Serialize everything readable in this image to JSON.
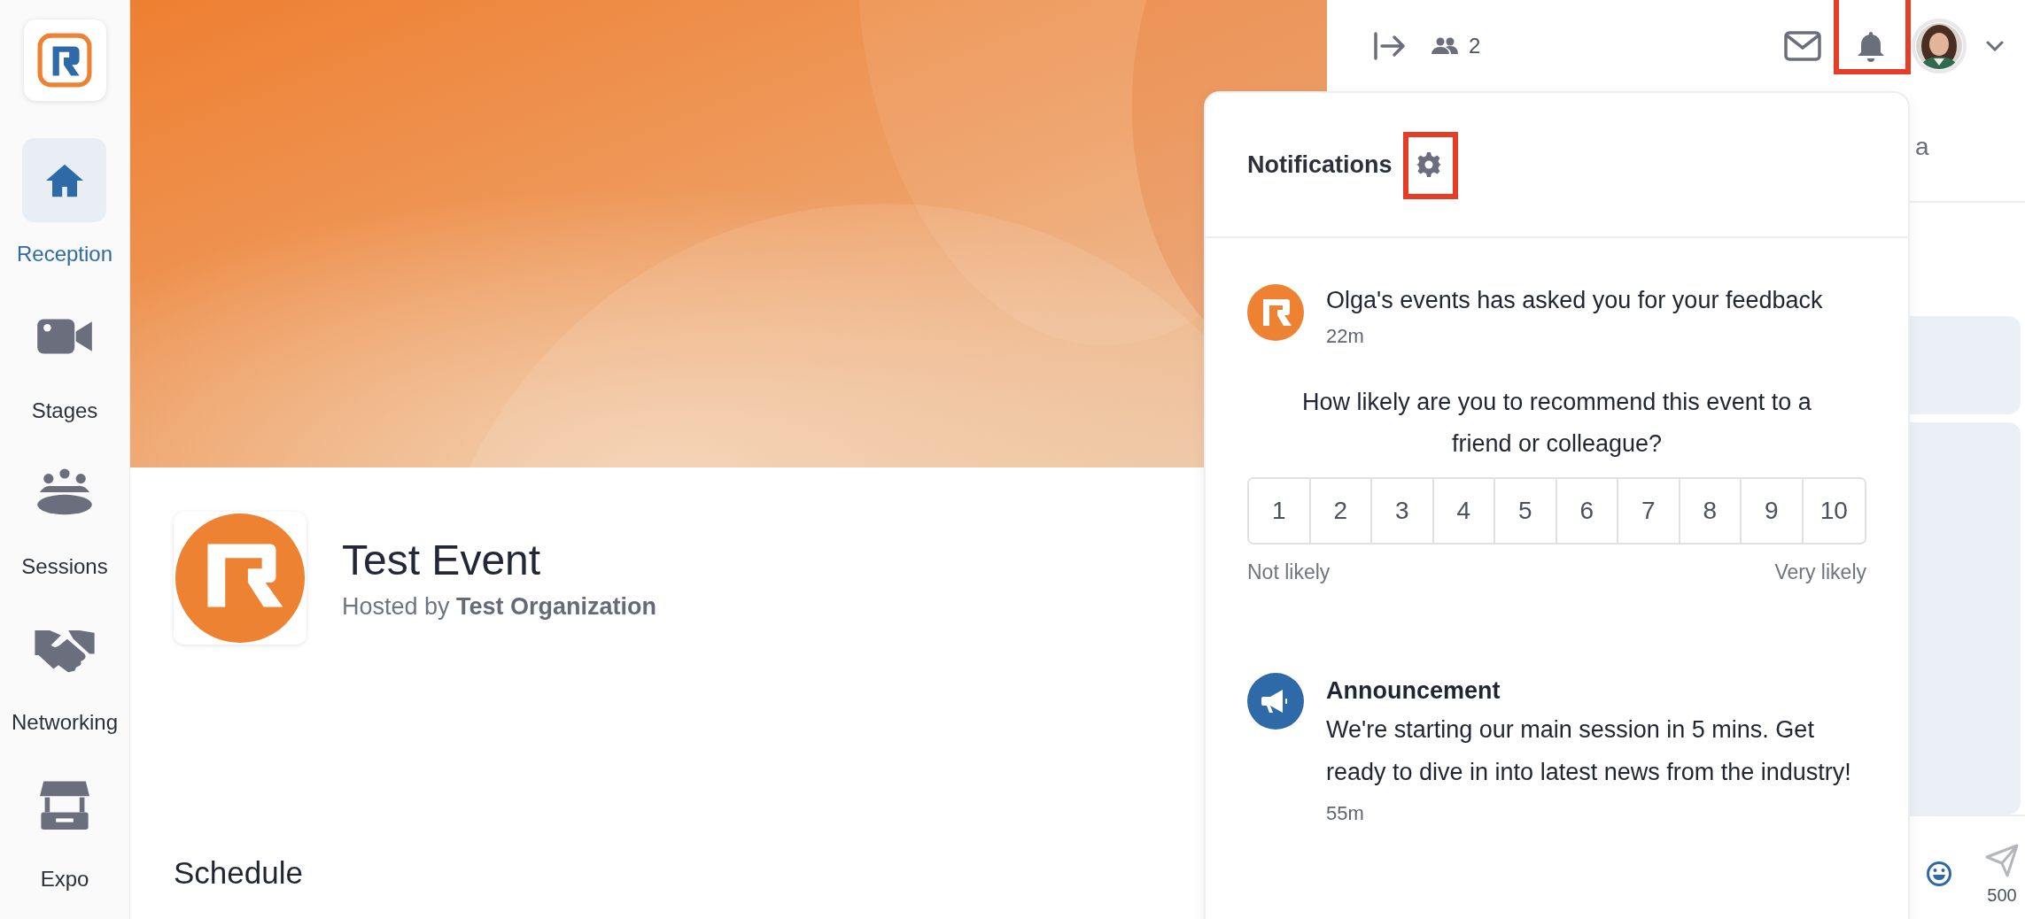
{
  "sidebar": {
    "items": [
      {
        "label": "Reception",
        "kind": "home",
        "selected": true
      },
      {
        "label": "Stages",
        "kind": "video",
        "selected": false
      },
      {
        "label": "Sessions",
        "kind": "sessions",
        "selected": false
      },
      {
        "label": "Networking",
        "kind": "networking",
        "selected": false
      },
      {
        "label": "Expo",
        "kind": "expo",
        "selected": false
      }
    ]
  },
  "event": {
    "title": "Test Event",
    "hosted_by": "Hosted by **Test Organization**",
    "schedule_heading": "Schedule"
  },
  "top_bar": {
    "attendee_count": "2"
  },
  "chat_panel": {
    "tab_fragment": "a",
    "char_count": "500"
  },
  "notifications": {
    "title": "Notifications",
    "items": [
      {
        "kind": "survey",
        "text": "Olga's events has asked you for your feedback",
        "time": "22m",
        "question": "How likely are you to recommend this event to a friend or colleague?",
        "scale": [
          "1",
          "2",
          "3",
          "4",
          "5",
          "6",
          "7",
          "8",
          "9",
          "10"
        ],
        "low_label": "Not likely",
        "high_label": "Very likely"
      },
      {
        "kind": "announcement",
        "title": "Announcement",
        "text": "We're starting our main session in 5 mins. Get ready to dive in into latest news from the industry!",
        "time": "55m"
      }
    ]
  }
}
